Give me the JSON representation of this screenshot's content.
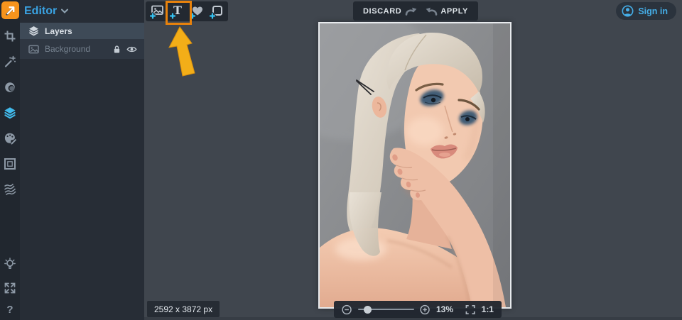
{
  "app": {
    "name": "photo-editor",
    "colors": {
      "accent_orange": "#f7941d",
      "highlight_box": "#e8820c",
      "arrow_yellow": "#f3ae18",
      "accent_blue": "#45aee8",
      "layers_active_blue": "#41b9ea",
      "panel_bg": "#272d36",
      "canvas_bg": "#40464e",
      "bar_bg": "#232931"
    }
  },
  "rail": {
    "tools": [
      {
        "name": "crop"
      },
      {
        "name": "adjust-wand"
      },
      {
        "name": "beauty-retouch"
      },
      {
        "name": "layers",
        "active": true
      },
      {
        "name": "effects-palette"
      },
      {
        "name": "frame"
      },
      {
        "name": "texture"
      }
    ],
    "bottom_tools": [
      {
        "name": "tips-bulb"
      },
      {
        "name": "fullscreen"
      },
      {
        "name": "help"
      }
    ],
    "help_label": "?"
  },
  "panel": {
    "title": "Editor",
    "layers_header": "Layers",
    "layers": [
      {
        "label": "Background",
        "locked": true,
        "visible": true
      }
    ]
  },
  "toolbar": {
    "buttons": [
      "add-image",
      "add-text",
      "add-sticker",
      "add-frame"
    ],
    "highlighted": "add-text"
  },
  "actions": {
    "discard": "DISCARD",
    "apply": "APPLY"
  },
  "account": {
    "sign_in": "Sign in"
  },
  "canvas": {
    "image_size": "2592 x 3872 px",
    "zoom_percent": "13%",
    "ratio_label": "1:1"
  }
}
